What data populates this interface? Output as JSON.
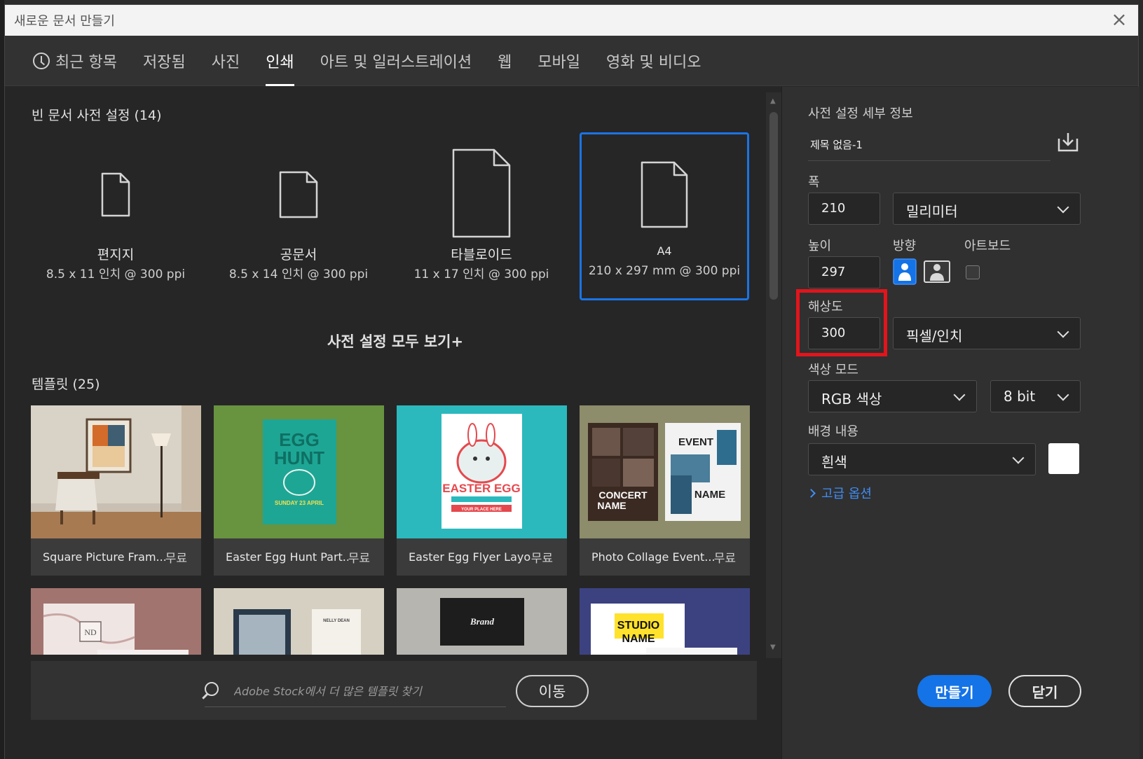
{
  "window": {
    "title": "새로운 문서 만들기",
    "close_glyph": "×"
  },
  "tabs": [
    {
      "label": "최근 항목"
    },
    {
      "label": "저장됨"
    },
    {
      "label": "사진"
    },
    {
      "label": "인쇄"
    },
    {
      "label": "아트 및 일러스트레이션"
    },
    {
      "label": "웹"
    },
    {
      "label": "모바일"
    },
    {
      "label": "영화 및 비디오"
    }
  ],
  "active_tab": "인쇄",
  "presets_section": {
    "title": "빈 문서 사전 설정 (14)"
  },
  "presets": [
    {
      "name": "편지지",
      "dimensions": "8.5 x 11 인치 @ 300 ppi"
    },
    {
      "name": "공문서",
      "dimensions": "8.5 x 14 인치 @ 300 ppi"
    },
    {
      "name": "타블로이드",
      "dimensions": "11 x 17 인치 @ 300 ppi"
    },
    {
      "name": "A4",
      "dimensions": "210 x 297 mm @ 300 ppi"
    }
  ],
  "view_all": "사전 설정 모두 보기+",
  "templates_section": {
    "title": "템플릿 (25)"
  },
  "templates": [
    {
      "name": "Square Picture Fram...",
      "price": "무료"
    },
    {
      "name": "Easter Egg Hunt Part...",
      "price": "무료"
    },
    {
      "name": "Easter Egg Flyer Layo...",
      "price": "무료"
    },
    {
      "name": "Photo Collage Event...",
      "price": "무료"
    }
  ],
  "template_thumb_text": {
    "egg_hunt": [
      "EGG",
      "HUNT",
      "SUNDAY 23 APRIL"
    ],
    "easter_egg": [
      "EASTER EGG",
      "YOUR PLACE HERE"
    ],
    "collage": [
      "CONCERT",
      "NAME",
      "EVENT",
      "NAME"
    ],
    "marble": "ND",
    "card_name": "NELLY DEAN",
    "brand": "Brand",
    "studio": [
      "STUDIO",
      "NAME"
    ]
  },
  "stock": {
    "placeholder": "Adobe Stock에서 더 많은 템플릿 찾기",
    "go_label": "이동"
  },
  "details": {
    "title": "사전 설정 세부 정보",
    "doc_name": "제목 없음-1",
    "width_label": "폭",
    "width_value": "210",
    "width_unit": "밀리미터",
    "height_label": "높이",
    "height_value": "297",
    "orientation_label": "방향",
    "artboard_label": "아트보드",
    "artboard_checked": false,
    "orientation": "portrait",
    "resolution_label": "해상도",
    "resolution_value": "300",
    "resolution_unit": "픽셀/인치",
    "color_mode_label": "색상 모드",
    "color_mode": "RGB 색상",
    "bit_depth": "8 bit",
    "background_label": "배경 내용",
    "background": "흰색",
    "background_color": "#ffffff",
    "advanced": "고급 옵션"
  },
  "buttons": {
    "create": "만들기",
    "close": "닫기"
  },
  "colors": {
    "accent": "#1473e6",
    "highlight": "#e3141b",
    "link": "#3f8ef5"
  }
}
